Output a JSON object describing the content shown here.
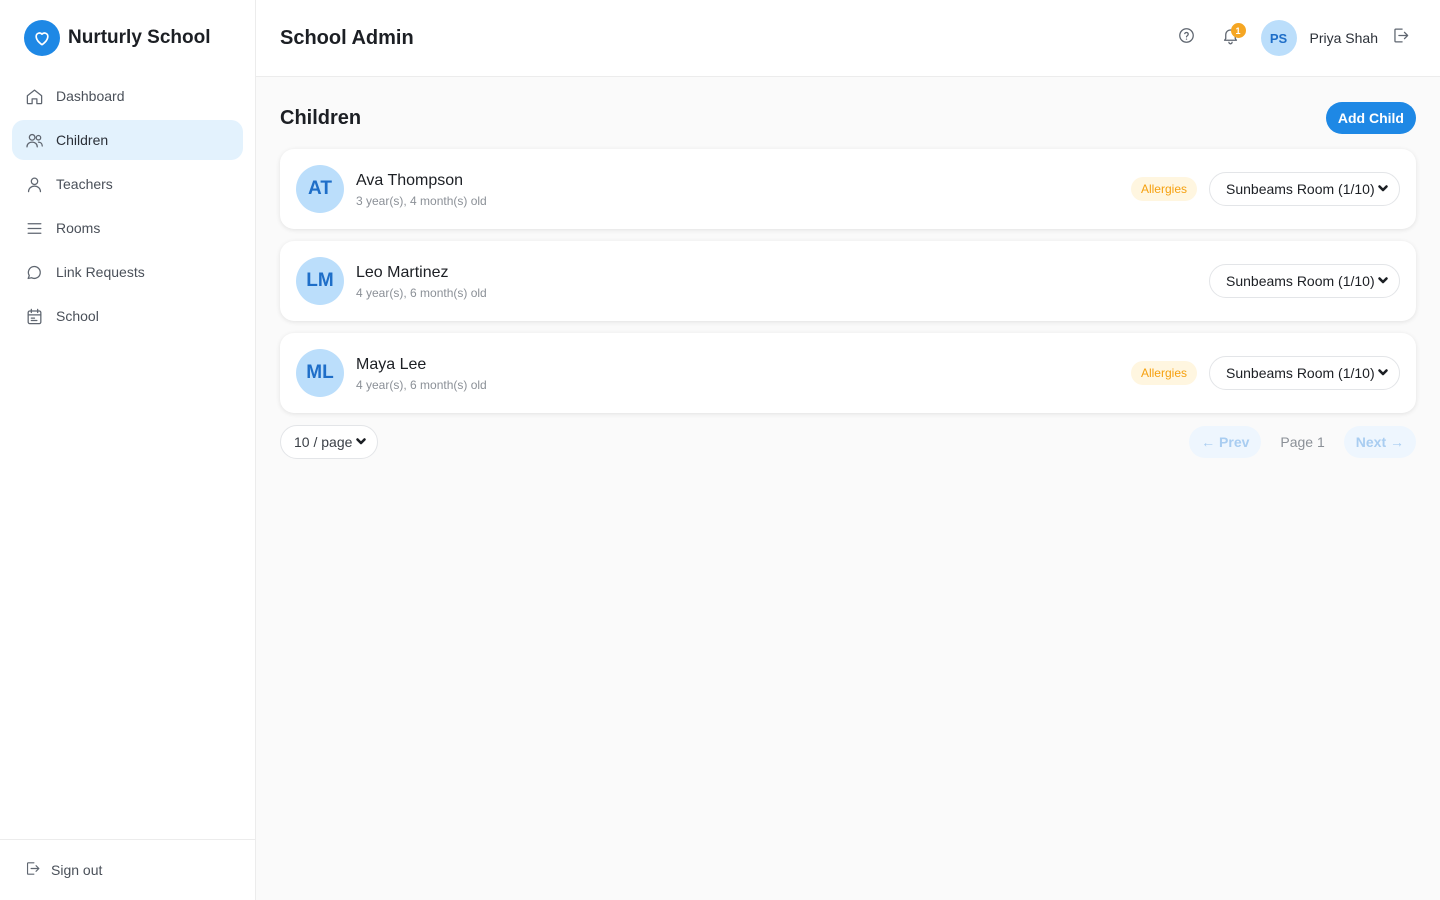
{
  "brand": {
    "name": "Nurturly School",
    "icon": "heart-icon",
    "color": "#1e88e5"
  },
  "sidebar": {
    "items": [
      {
        "label": "Dashboard",
        "icon": "home-icon",
        "active": false
      },
      {
        "label": "Children",
        "icon": "users-icon",
        "active": true
      },
      {
        "label": "Teachers",
        "icon": "user-icon",
        "active": false
      },
      {
        "label": "Rooms",
        "icon": "menu-icon",
        "active": false
      },
      {
        "label": "Link Requests",
        "icon": "chat-bubble-icon",
        "active": false
      },
      {
        "label": "School",
        "icon": "calendar-icon",
        "active": false
      }
    ],
    "sign_out": "Sign out"
  },
  "header": {
    "title": "School Admin",
    "notification_count": "1",
    "user": {
      "initials": "PS",
      "name": "Priya Shah"
    }
  },
  "main": {
    "title": "Children",
    "add_button": "Add Child",
    "children": [
      {
        "initials": "AT",
        "name": "Ava Thompson",
        "age": "3 year(s), 4 month(s) old",
        "badge": "Allergies",
        "room": "Sunbeams Room (1/10)"
      },
      {
        "initials": "LM",
        "name": "Leo Martinez",
        "age": "4 year(s), 6 month(s) old",
        "badge": "",
        "room": "Sunbeams Room (1/10)"
      },
      {
        "initials": "ML",
        "name": "Maya Lee",
        "age": "4 year(s), 6 month(s) old",
        "badge": "Allergies",
        "room": "Sunbeams Room (1/10)"
      }
    ],
    "pagination": {
      "page_size": "10 / page",
      "prev": "← Prev",
      "page_label": "Page 1",
      "next": "Next →"
    }
  },
  "colors": {
    "accent": "#1e88e5",
    "active_nav": "#e3f2fd",
    "avatar_bg": "#bbdefb",
    "allergy": "#f5a00f",
    "badge": "#f5a623"
  }
}
